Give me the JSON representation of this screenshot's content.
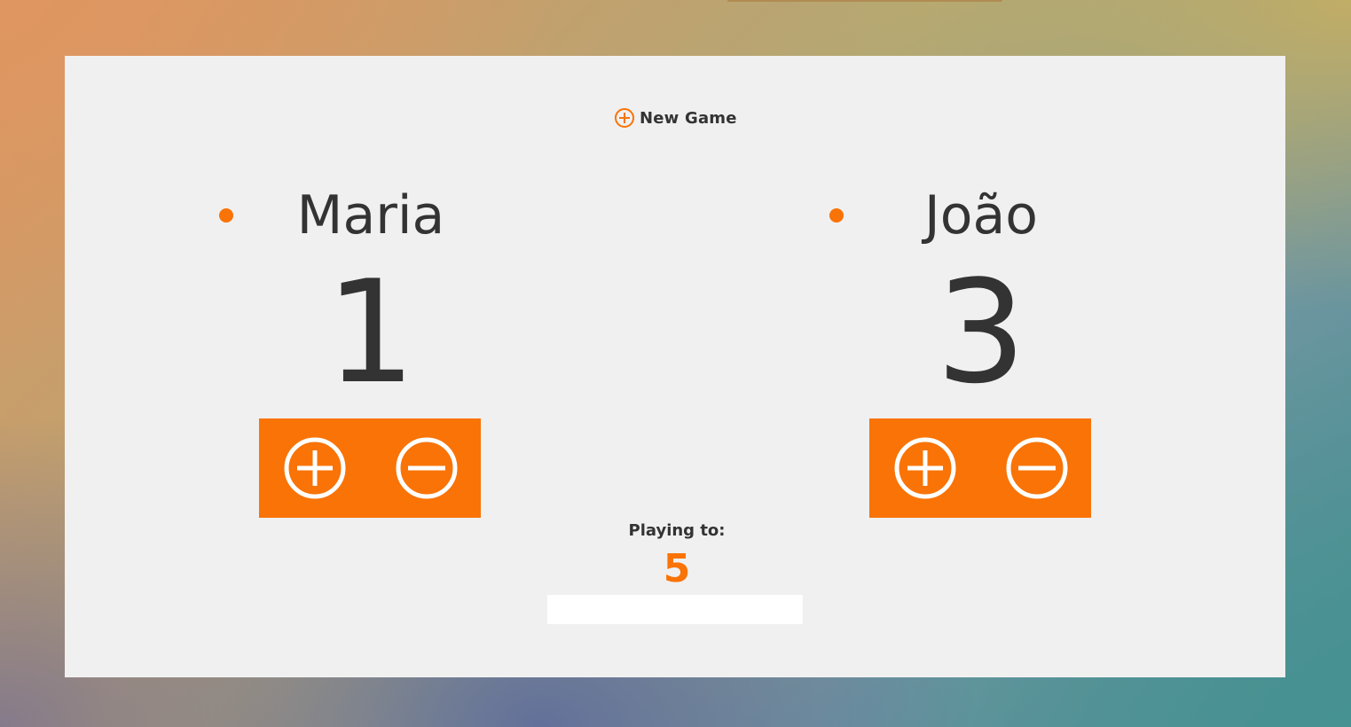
{
  "toolbar": {
    "new_game_label": "New Game",
    "new_game_icon": "plus-circle-icon"
  },
  "players": [
    {
      "name": "Maria",
      "score": "1",
      "add_icon": "plus-circle-icon",
      "remove_icon": "minus-circle-icon"
    },
    {
      "name": "João",
      "score": "3",
      "add_icon": "plus-circle-icon",
      "remove_icon": "minus-circle-icon"
    }
  ],
  "target": {
    "label": "Playing to:",
    "value": "5",
    "input_value": ""
  },
  "colors": {
    "accent": "#f97306",
    "panel": "#f0f0f0",
    "text": "#333333"
  }
}
